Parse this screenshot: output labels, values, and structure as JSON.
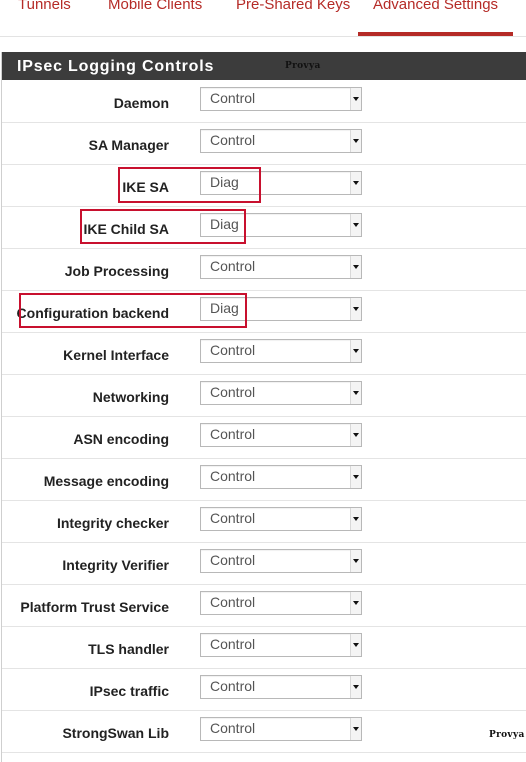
{
  "tabs": [
    {
      "label": "Tunnels",
      "active": false
    },
    {
      "label": "Mobile Clients",
      "active": false
    },
    {
      "label": "Pre-Shared Keys",
      "active": false
    },
    {
      "label": "Advanced Settings",
      "active": true
    }
  ],
  "panel": {
    "title": "IPsec Logging Controls",
    "watermark": "Provya"
  },
  "rows": [
    {
      "label": "Daemon",
      "value": "Control"
    },
    {
      "label": "SA Manager",
      "value": "Control"
    },
    {
      "label": "IKE SA",
      "value": "Diag"
    },
    {
      "label": "IKE Child SA",
      "value": "Diag"
    },
    {
      "label": "Job Processing",
      "value": "Control"
    },
    {
      "label": "Configuration backend",
      "value": "Diag"
    },
    {
      "label": "Kernel Interface",
      "value": "Control"
    },
    {
      "label": "Networking",
      "value": "Control"
    },
    {
      "label": "ASN encoding",
      "value": "Control"
    },
    {
      "label": "Message encoding",
      "value": "Control"
    },
    {
      "label": "Integrity checker",
      "value": "Control"
    },
    {
      "label": "Integrity Verifier",
      "value": "Control"
    },
    {
      "label": "Platform Trust Service",
      "value": "Control"
    },
    {
      "label": "TLS handler",
      "value": "Control"
    },
    {
      "label": "IPsec traffic",
      "value": "Control"
    },
    {
      "label": "StrongSwan Lib",
      "value": "Control"
    }
  ],
  "footer_watermark": "Provya",
  "colors": {
    "accent": "#b52b27",
    "heading_bg": "#3c3c3c",
    "highlight": "#c8102e"
  }
}
